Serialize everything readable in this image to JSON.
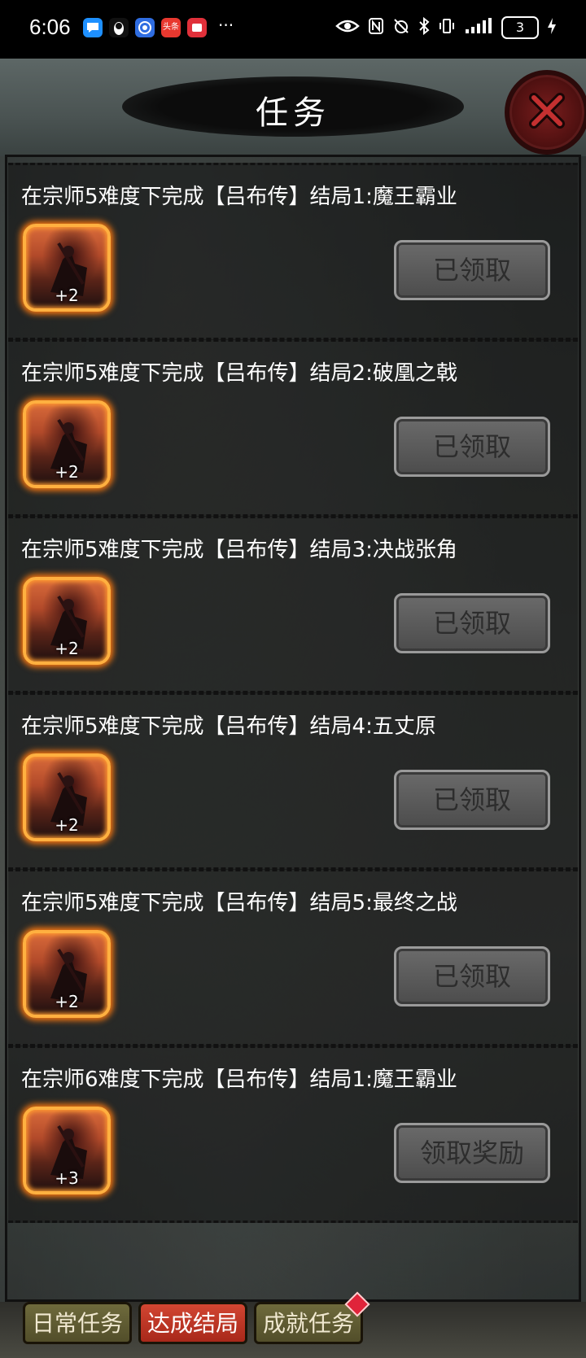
{
  "status_bar": {
    "time": "6:06",
    "app_icons": [
      {
        "name": "chat-bubble-icon",
        "label": "",
        "color": "#1e90ff"
      },
      {
        "name": "penguin-icon",
        "label": "",
        "color": "#222222"
      },
      {
        "name": "browser-icon",
        "label": "",
        "color": "#2f6de1"
      },
      {
        "name": "toutiao-icon",
        "label": "头条",
        "color": "#e8382f"
      },
      {
        "name": "red-app-icon",
        "label": "",
        "color": "#e0303a"
      }
    ],
    "more": "···",
    "battery": "3"
  },
  "header": {
    "title": "任务",
    "close_icon": "close-x-icon"
  },
  "tasks": [
    {
      "text": "在宗师5难度下完成【吕布传】结局1:魔王霸业",
      "reward_count": "+2",
      "button": "已领取"
    },
    {
      "text": "在宗师5难度下完成【吕布传】结局2:破凰之戟",
      "reward_count": "+2",
      "button": "已领取"
    },
    {
      "text": "在宗师5难度下完成【吕布传】结局3:决战张角",
      "reward_count": "+2",
      "button": "已领取"
    },
    {
      "text": "在宗师5难度下完成【吕布传】结局4:五丈原",
      "reward_count": "+2",
      "button": "已领取"
    },
    {
      "text": "在宗师5难度下完成【吕布传】结局5:最终之战",
      "reward_count": "+2",
      "button": "已领取"
    },
    {
      "text": "在宗师6难度下完成【吕布传】结局1:魔王霸业",
      "reward_count": "+3",
      "button": "领取奖励"
    }
  ],
  "tabs": [
    {
      "label": "日常任务",
      "active": false
    },
    {
      "label": "达成结局",
      "active": true
    },
    {
      "label": "成就任务",
      "active": false,
      "badge": true
    }
  ],
  "colors": {
    "accent_tab": "#d24632",
    "reward_glow": "#ff7a10"
  }
}
